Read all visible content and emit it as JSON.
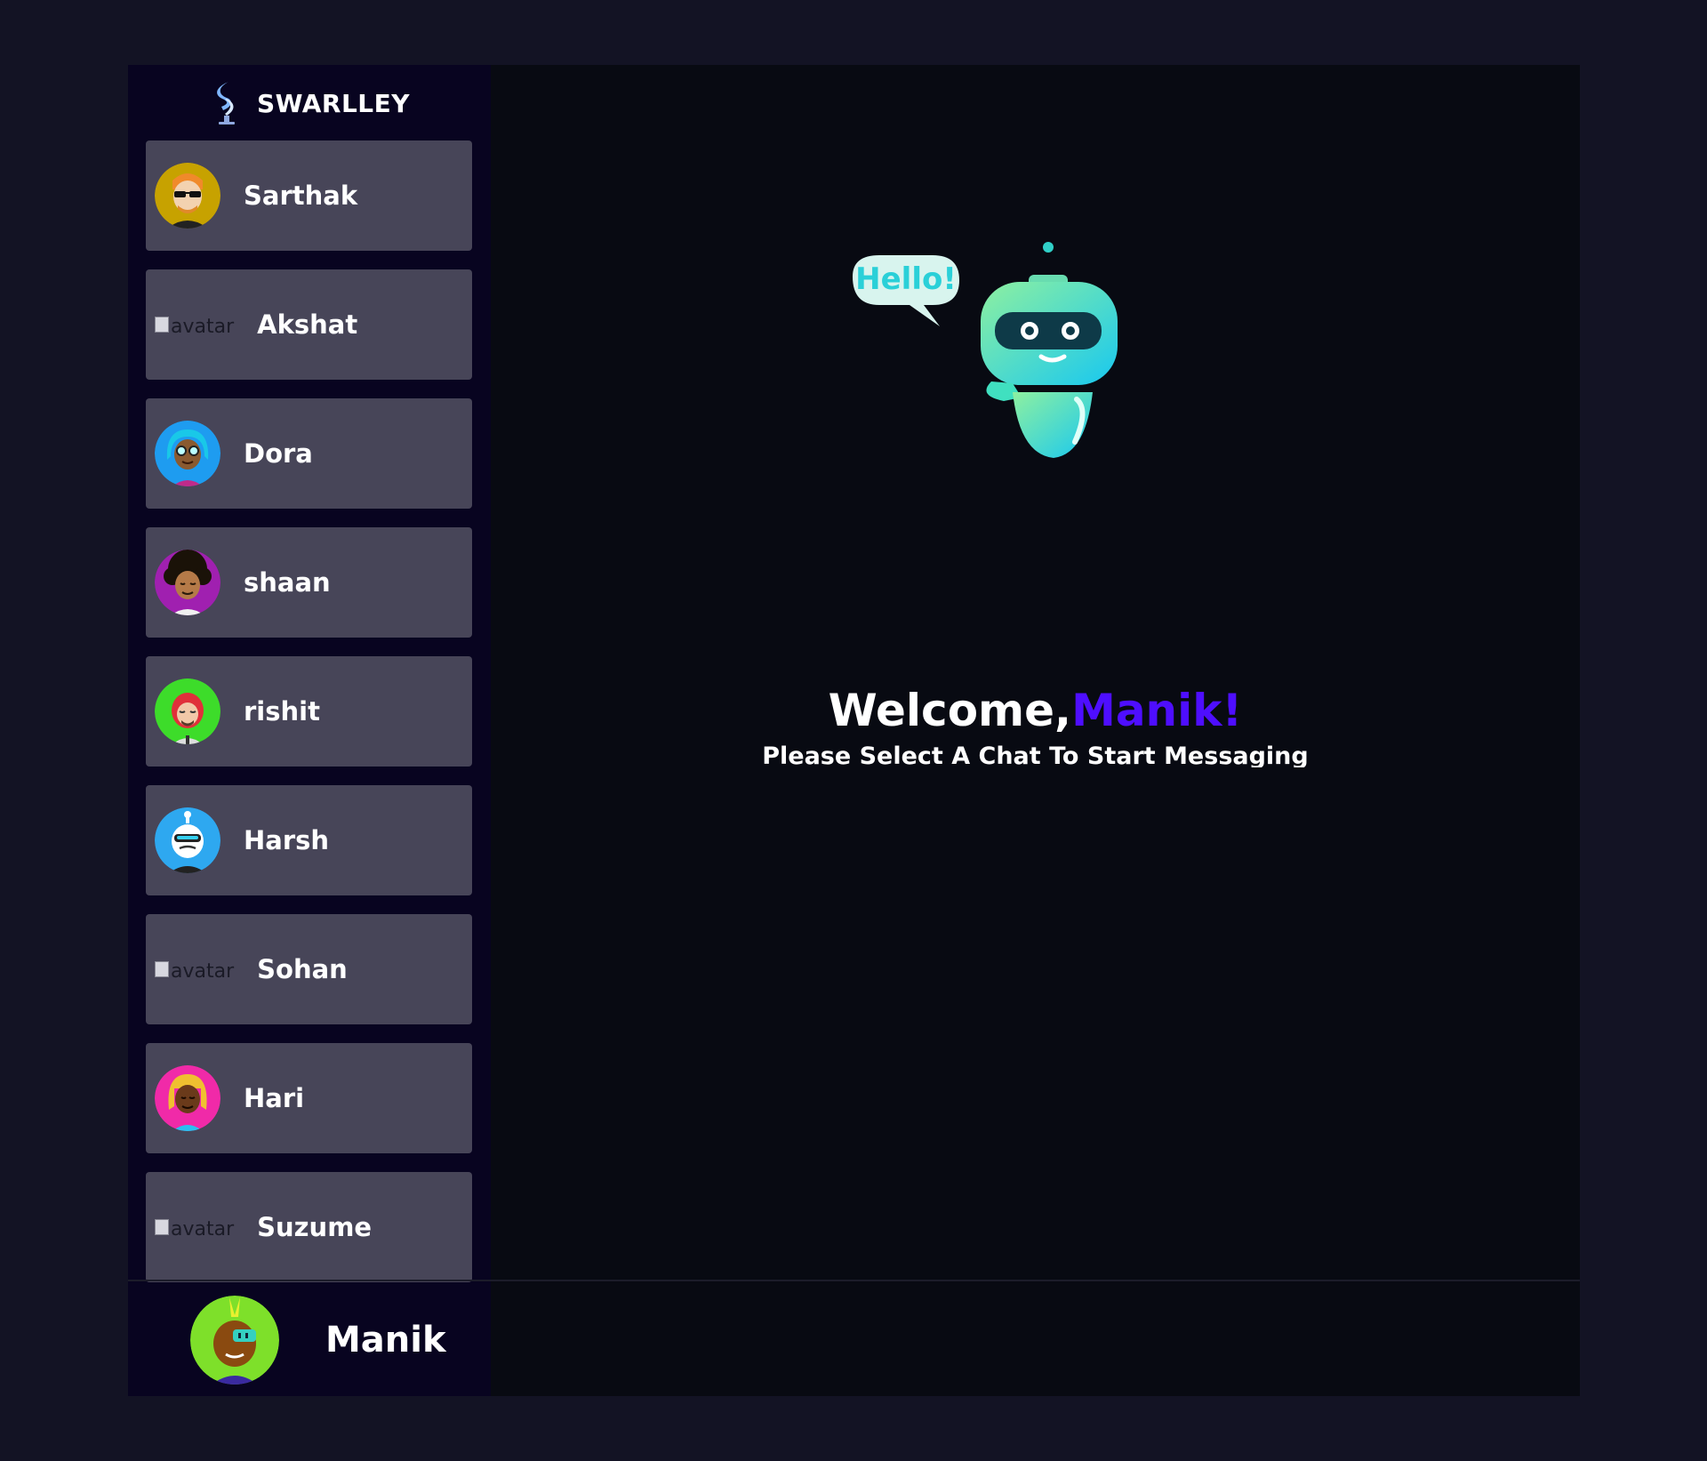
{
  "brand": {
    "name": "SWARLLEY",
    "logo_icon": "swirl-logo-icon"
  },
  "contacts": [
    {
      "name": "Sarthak",
      "avatar": "avatar-sunglasses-man",
      "avatar_bg": "#c7a200",
      "broken": false
    },
    {
      "name": "Akshat",
      "avatar_alt": "avatar",
      "broken": true
    },
    {
      "name": "Dora",
      "avatar": "avatar-glasses-woman",
      "avatar_bg": "#1e9cf0",
      "broken": false
    },
    {
      "name": "shaan",
      "avatar": "avatar-curly-hair-man",
      "avatar_bg": "#a020b0",
      "broken": false
    },
    {
      "name": "rishit",
      "avatar": "avatar-masked-man",
      "avatar_bg": "#3ddc2a",
      "broken": false
    },
    {
      "name": "Harsh",
      "avatar": "avatar-robot-man",
      "avatar_bg": "#2ea8f0",
      "broken": false
    },
    {
      "name": "Sohan",
      "avatar_alt": "avatar",
      "broken": true
    },
    {
      "name": "Hari",
      "avatar": "avatar-blonde-woman",
      "avatar_bg": "#f02aa8",
      "broken": false
    },
    {
      "name": "Suzume",
      "avatar_alt": "avatar",
      "broken": true
    }
  ],
  "current_user": {
    "name": "Manik",
    "avatar": "avatar-mohawk-man",
    "avatar_bg": "#7ee02a"
  },
  "welcome": {
    "greeting": "Welcome,",
    "username": "Manik!",
    "subtitle": "Please Select A Chat To Start Messaging",
    "illustration": "hello-robot-illustration",
    "bubble_text": "Hello!"
  },
  "colors": {
    "accent": "#4e0eff",
    "contact_bg": "#474558",
    "sidebar_bg": "#080420",
    "chat_bg": "#080a12",
    "page_bg": "#131324"
  }
}
